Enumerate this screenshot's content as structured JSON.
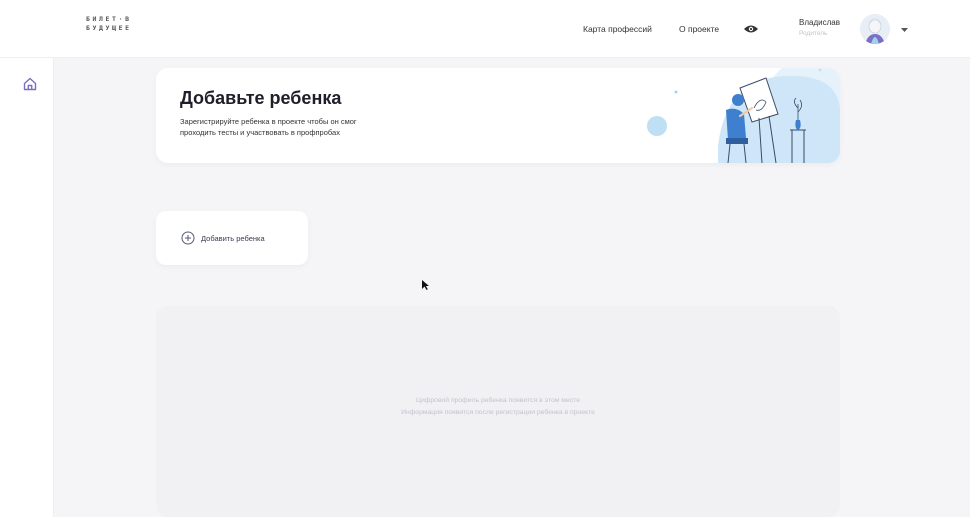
{
  "header": {
    "logo_line1": "БИЛЕТ·В",
    "logo_line2": "БУДУЩЕЕ",
    "nav": {
      "professions_map": "Карта профессий",
      "about": "О проекте"
    },
    "user": {
      "name": "Владислав",
      "role": "Родитель"
    },
    "icons": {
      "accessibility": "eye-icon",
      "menu": "chevron-down-icon"
    }
  },
  "sidebar": {
    "icons": [
      "home-icon"
    ]
  },
  "banner": {
    "title": "Добавьте ребенка",
    "text_line1": "Зарегистрируйте ребенка в проекте чтобы он смог",
    "text_line2": "проходить тесты и участвовать в профпробах"
  },
  "add_child": {
    "label": "Добавить ребенка",
    "icon": "plus-circle-icon"
  },
  "empty_state": {
    "line1": "Цифровой профиль ребенка появится в этом месте",
    "line2": "Информация появится после регистрации ребенка в проекте"
  },
  "colors": {
    "background": "#f5f5f7",
    "card": "#ffffff",
    "accent": "#7b6fc4",
    "illustration_blue": "#cfe6f8"
  }
}
